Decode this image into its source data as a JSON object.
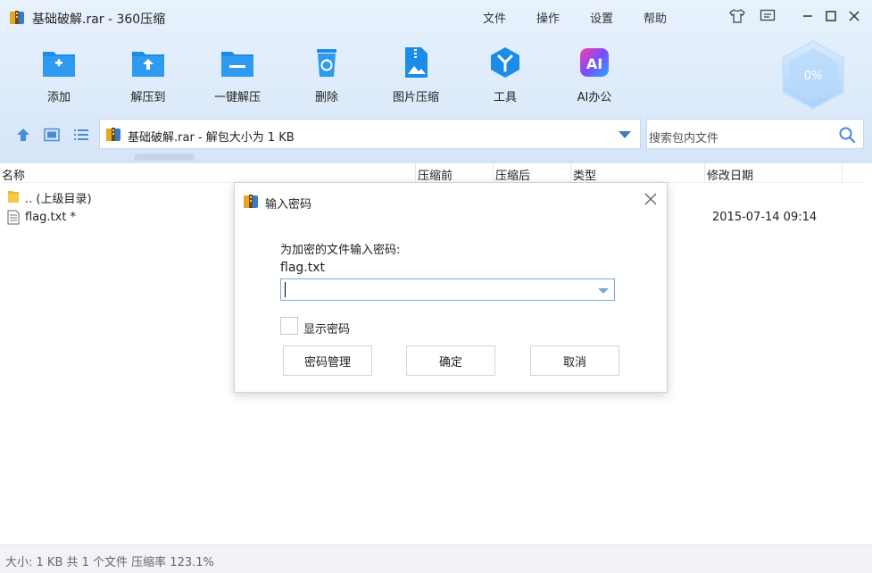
{
  "window": {
    "title": "基础破解.rar - 360压缩",
    "menu": [
      "文件",
      "操作",
      "设置",
      "帮助"
    ]
  },
  "toolbar": {
    "buttons": [
      {
        "label": "添加",
        "icon": "add-archive-icon"
      },
      {
        "label": "解压到",
        "icon": "extract-to-icon"
      },
      {
        "label": "一键解压",
        "icon": "one-click-extract-icon"
      },
      {
        "label": "删除",
        "icon": "recycle-delete-icon"
      },
      {
        "label": "图片压缩",
        "icon": "image-compress-icon"
      },
      {
        "label": "工具",
        "icon": "tools-icon"
      },
      {
        "label": "AI办公",
        "icon": "ai-office-icon"
      }
    ],
    "compression_gauge": "0%"
  },
  "nav": {
    "path_text": "基础破解.rar - 解包大小为 1 KB",
    "search_placeholder": "搜索包内文件"
  },
  "columns": {
    "name": "名称",
    "before": "压缩前",
    "after": "压缩后",
    "type": "类型",
    "modified": "修改日期"
  },
  "files": [
    {
      "name": ".. (上级目录)",
      "icon": "folder-icon",
      "modified": ""
    },
    {
      "name": "flag.txt *",
      "icon": "text-file-icon",
      "modified": "2015-07-14 09:14"
    }
  ],
  "status": "大小: 1 KB 共 1 个文件 压缩率 123.1%",
  "dialog": {
    "title": "输入密码",
    "prompt": "为加密的文件输入密码:",
    "filename": "flag.txt",
    "password_value": "",
    "show_password_label": "显示密码",
    "show_password_checked": false,
    "buttons": {
      "manage": "密码管理",
      "ok": "确定",
      "cancel": "取消"
    }
  },
  "colors": {
    "accent": "#1b8ce8",
    "toolbar_bg": "#dbe9fa",
    "status_bg": "#f1f3f6"
  }
}
